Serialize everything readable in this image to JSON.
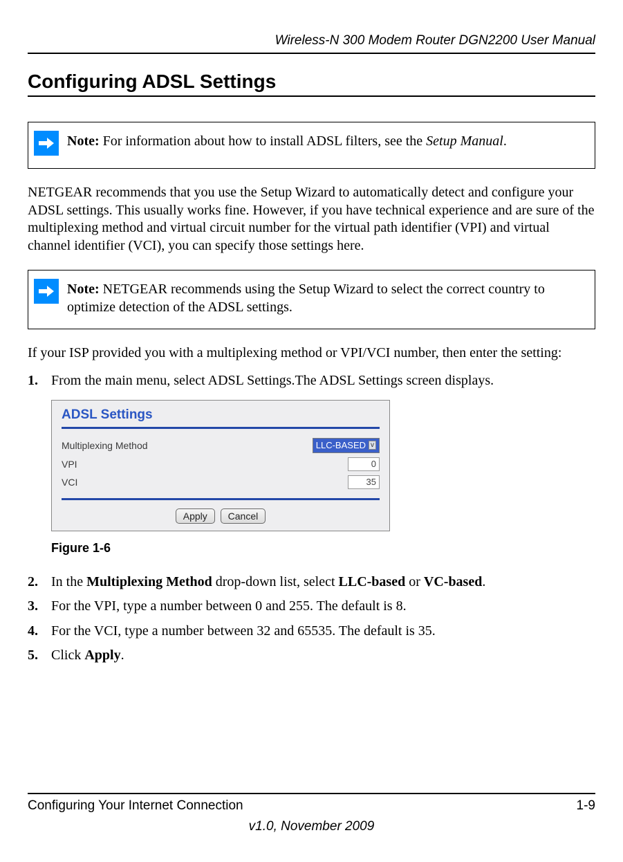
{
  "header": {
    "running_title": "Wireless-N 300 Modem Router DGN2200 User Manual"
  },
  "section": {
    "heading": "Configuring ADSL Settings"
  },
  "note1": {
    "label": "Note:",
    "text": " For information about how to install ADSL filters, see the ",
    "ref": "Setup Manual",
    "tail": "."
  },
  "para1": "NETGEAR recommends that you use the Setup Wizard to automatically detect and configure your ADSL settings. This usually works fine. However, if you have technical experience and are sure of the multiplexing method and virtual circuit number for the virtual path identifier (VPI) and virtual channel identifier (VCI), you can specify those settings here.",
  "note2": {
    "label": "Note:",
    "text": " NETGEAR recommends using the Setup Wizard to select the correct country to optimize detection of the ADSL settings."
  },
  "para2": "If your ISP provided you with a multiplexing method or VPI/VCI number, then enter the setting:",
  "steps": {
    "s1": {
      "num": "1.",
      "text": "From the main menu, select ADSL Settings.The ADSL Settings screen displays."
    },
    "s2": {
      "num": "2.",
      "pre": "In the ",
      "b1": "Multiplexing Method",
      "mid": " drop-down list, select ",
      "b2": "LLC-based",
      "mid2": " or ",
      "b3": "VC-based",
      "tail": "."
    },
    "s3": {
      "num": "3.",
      "text": "For the VPI, type a number between 0 and 255. The default is 8."
    },
    "s4": {
      "num": "4.",
      "text": "For the VCI, type a number between 32 and 65535. The default is 35."
    },
    "s5": {
      "num": "5.",
      "pre": "Click ",
      "b1": "Apply",
      "tail": "."
    }
  },
  "figure": {
    "title": "ADSL Settings",
    "row_mux_label": "Multiplexing Method",
    "row_mux_value": "LLC-BASED",
    "row_vpi_label": "VPI",
    "row_vpi_value": "0",
    "row_vci_label": "VCI",
    "row_vci_value": "35",
    "apply": "Apply",
    "cancel": "Cancel",
    "caption": "Figure 1-6"
  },
  "footer": {
    "left": "Configuring Your Internet Connection",
    "right": "1-9",
    "bottom": "v1.0, November 2009"
  }
}
